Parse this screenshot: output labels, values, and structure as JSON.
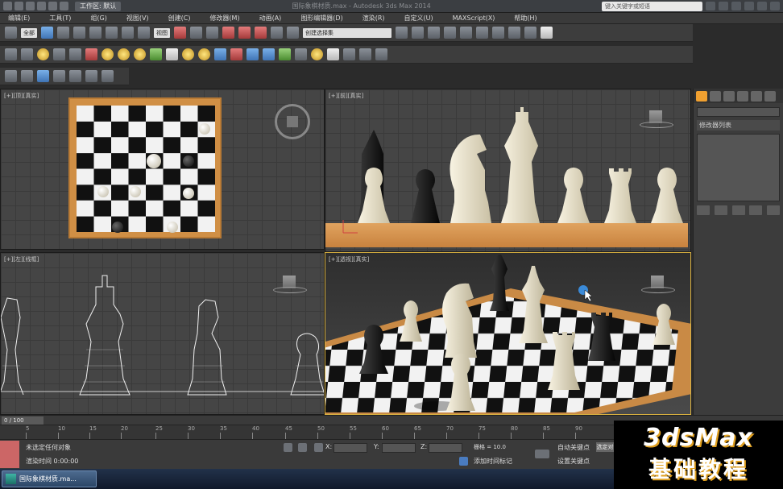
{
  "title_bar": {
    "workspace_label": "工作区: 默认",
    "window_title": "国际象棋材质.max - Autodesk 3ds Max 2014",
    "search_placeholder": "键入关键字或短语"
  },
  "menu": [
    "编辑(E)",
    "工具(T)",
    "组(G)",
    "视图(V)",
    "创建(C)",
    "修改器(M)",
    "动画(A)",
    "图形编辑器(D)",
    "渲染(R)",
    "自定义(U)",
    "MAXScript(X)",
    "帮助(H)"
  ],
  "toolbar": {
    "selection_filter": "全部",
    "reference_coord": "视图",
    "named_selection": "创建选择集"
  },
  "viewports": {
    "top_right_label": "[+][前][真实]",
    "bottom_right_label": "[+][透视][真实]",
    "top_left_label": "[+][顶][真实]",
    "bottom_left_label": "[+][左][线框]"
  },
  "command_panel": {
    "modifier_list": "修改器列表"
  },
  "timeline": {
    "frame_counter": "0 / 100",
    "ticks": [
      "5",
      "10",
      "15",
      "20",
      "25",
      "30",
      "35",
      "40",
      "45",
      "50",
      "55",
      "60",
      "65",
      "70",
      "75",
      "80",
      "85",
      "90"
    ]
  },
  "status": {
    "selection_text": "未选定任何对象",
    "render_time": "渲染时间 0:00:00",
    "x_label": "X:",
    "y_label": "Y:",
    "z_label": "Z:",
    "grid_text": "栅格 = 10.0",
    "add_time_tag": "添加时间标记",
    "auto_key": "自动关键点",
    "set_key": "设置关键点",
    "selected_btn": "选定对"
  },
  "taskbar": {
    "item_label": "国际象棋材质.ma..."
  },
  "watermark": {
    "line1": "3dsMax",
    "line2": "基础教程"
  },
  "icons": [
    "undo-icon",
    "redo-icon",
    "select-icon",
    "move-icon",
    "rotate-icon",
    "scale-icon",
    "snap-icon",
    "mirror-icon",
    "align-icon",
    "render-icon",
    "material-editor-icon",
    "teapot-icon"
  ]
}
